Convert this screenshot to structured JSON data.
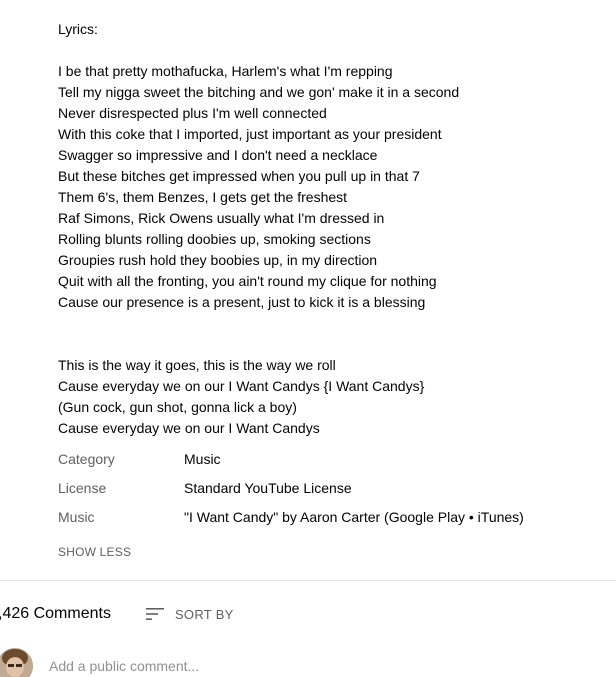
{
  "description": {
    "heading": "Lyrics:",
    "verse": [
      "I be that pretty mothafucka, Harlem's what I'm repping",
      "Tell my nigga sweet the bitching and we gon' make it in a second",
      "Never disrespected plus I'm well connected",
      "With this coke that I imported, just important as your president",
      "Swagger so impressive and I don't need a necklace",
      "But these bitches get impressed when you pull up in that 7",
      "Them 6's, them Benzes, I gets get the freshest",
      "Raf Simons, Rick Owens usually what I'm dressed in",
      "Rolling blunts rolling doobies up, smoking sections",
      "Groupies rush hold they boobies up, in my direction",
      "Quit with all the fronting, you ain't round my clique for nothing",
      "Cause our presence is a present, just to kick it is a blessing"
    ],
    "chorus": [
      "This is the way it goes, this is the way we roll",
      "Cause everyday we on our I Want Candys {I Want Candys}",
      "(Gun cock, gun shot, gonna lick a boy)",
      "Cause everyday we on our I Want Candys"
    ]
  },
  "metadata": [
    {
      "label": "Category",
      "value": "Music"
    },
    {
      "label": "License",
      "value": "Standard YouTube License"
    },
    {
      "label": "Music",
      "value": "\"I Want Candy\" by Aaron Carter (Google Play • iTunes)"
    }
  ],
  "show_less_label": "SHOW LESS",
  "comments": {
    "count_label": ",426 Comments",
    "sort_label": "SORT BY",
    "sort_icon": "sort-icon",
    "add_placeholder": "Add a public comment..."
  }
}
